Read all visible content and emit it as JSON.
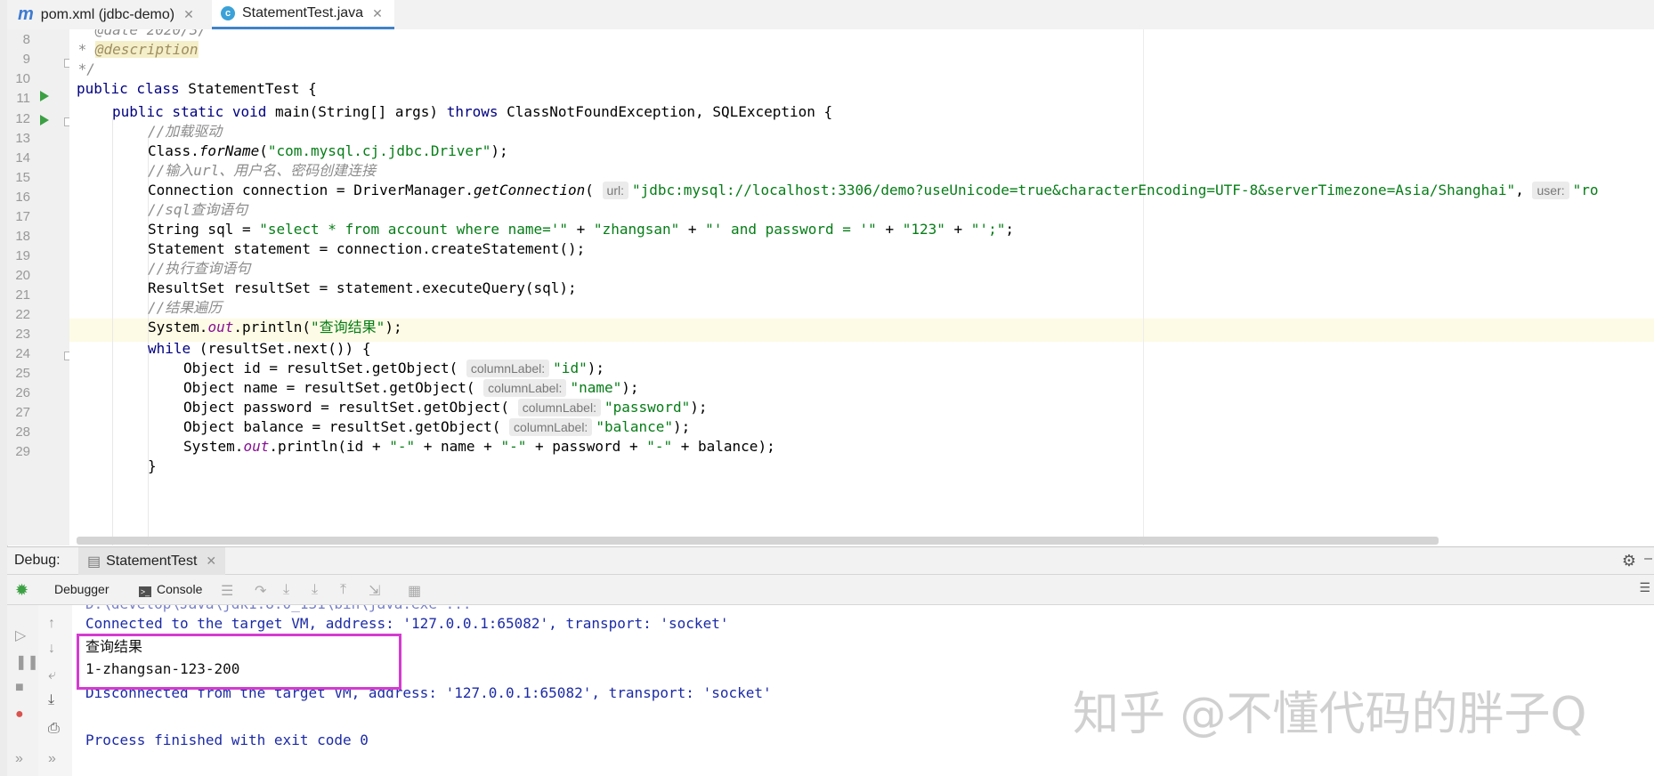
{
  "tabs": [
    {
      "icon": "m",
      "label": "pom.xml (jdbc-demo)",
      "active": false
    },
    {
      "icon": "c",
      "label": "StatementTest.java",
      "active": true
    }
  ],
  "editor": {
    "line_numbers": [
      "8",
      "9",
      "10",
      "11",
      "12",
      "13",
      "14",
      "15",
      "16",
      "17",
      "18",
      "19",
      "20",
      "21",
      "22",
      "23",
      "24",
      "25",
      "26",
      "27",
      "28",
      "29"
    ],
    "lines": {
      "l7_partial": "   @date 2020/3/",
      "l8_star": " * ",
      "l8_tag": "@description",
      "l9": " */",
      "l10_kw": "public class ",
      "l10_rest": "StatementTest {",
      "l11_kw1": "public static void ",
      "l11_mid": "main(String[] args) ",
      "l11_kw2": "throws ",
      "l11_rest": "ClassNotFoundException, SQLException {",
      "l12": "//加载驱动",
      "l13_a": "Class.",
      "l13_b": "forName",
      "l13_c": "(",
      "l13_str": "\"com.mysql.cj.jdbc.Driver\"",
      "l13_d": ");",
      "l14": "//输入url、用户名、密码创建连接",
      "l15_a": "Connection connection = DriverManager.",
      "l15_b": "getConnection",
      "l15_c": "( ",
      "l15_hint1": "url:",
      "l15_str": "\"jdbc:mysql://localhost:3306/demo?useUnicode=true&characterEncoding=UTF-8&serverTimezone=Asia/Shanghai\"",
      "l15_d": ", ",
      "l15_hint2": "user:",
      "l15_str2": "\"ro",
      "l16": "//sql查询语句",
      "l17_a": "String sql = ",
      "l17_s1": "\"select * from account where name='\"",
      "l17_p1": " + ",
      "l17_s2": "\"zhangsan\"",
      "l17_p2": " + ",
      "l17_s3": "\"' and password = '\"",
      "l17_p3": " + ",
      "l17_s4": "\"123\"",
      "l17_p4": " + ",
      "l17_s5": "\"';\"",
      "l17_e": ";",
      "l18": "Statement statement = connection.createStatement();",
      "l19": "//执行查询语句",
      "l20": "ResultSet resultSet = statement.executeQuery(sql);",
      "l21": "//结果遍历",
      "l22_a": "System.",
      "l22_out": "out",
      "l22_b": ".println(",
      "l22_str": "\"查询结果\"",
      "l22_c": ");",
      "l23_kw": "while ",
      "l23_rest": "(resultSet.next()) {",
      "l24_a": "Object id = resultSet.getObject( ",
      "l24_str": "\"id\"",
      "l25_a": "Object name = resultSet.getObject( ",
      "l25_str": "\"name\"",
      "l26_a": "Object password = resultSet.getObject( ",
      "l26_str": "\"password\"",
      "l27_a": "Object balance = resultSet.getObject( ",
      "l27_str": "\"balance\"",
      "hint_col": "columnLabel:",
      "close": ");",
      "l28_a": "System.",
      "l28_out": "out",
      "l28_b": ".println(id + ",
      "l28_s1": "\"-\"",
      "l28_c": " + name + ",
      "l28_d": " + password + ",
      "l28_e": " + balance);",
      "l29": "}"
    }
  },
  "debug": {
    "label": "Debug:",
    "tab": "StatementTest",
    "debugger_label": "Debugger",
    "console_label": "Console"
  },
  "console": {
    "partial_top": "D:\\develop\\Java\\jdk1.8.0_131\\bin\\java.exe ...",
    "connected": "Connected to the target VM, address: '127.0.0.1:65082', transport: 'socket'",
    "result_title": "查询结果",
    "result_row": "1-zhangsan-123-200",
    "disconnected": "Disconnected from the target VM, address: '127.0.0.1:65082', transport: 'socket'",
    "finished": "Process finished with exit code 0"
  },
  "watermark": "知乎 @不懂代码的胖子Q",
  "colors": {
    "highlight_box": "#d53bd0",
    "accent_tab": "#4083c9"
  }
}
